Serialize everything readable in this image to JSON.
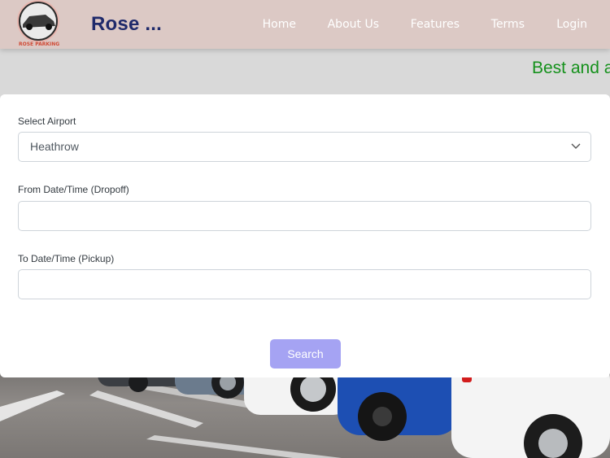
{
  "brand": {
    "name": "Rose ...",
    "logo_icon": "car-logo-icon",
    "logo_text": "ROSE PARKING"
  },
  "nav": {
    "items": [
      "Home",
      "About Us",
      "Features",
      "Terms",
      "Login"
    ]
  },
  "marquee": {
    "text": "Best and a"
  },
  "form": {
    "airport": {
      "label": "Select Airport",
      "value": "Heathrow",
      "icon": "chevron-down-icon"
    },
    "from": {
      "label": "From Date/Time (Dropoff)",
      "value": ""
    },
    "to": {
      "label": "To Date/Time (Pickup)",
      "value": ""
    },
    "search_label": "Search"
  },
  "colors": {
    "header_bg": "#dcc9c5",
    "brand_text": "#1f2a6b",
    "marquee_text": "#15911c",
    "button_bg": "#a5a3f3"
  }
}
